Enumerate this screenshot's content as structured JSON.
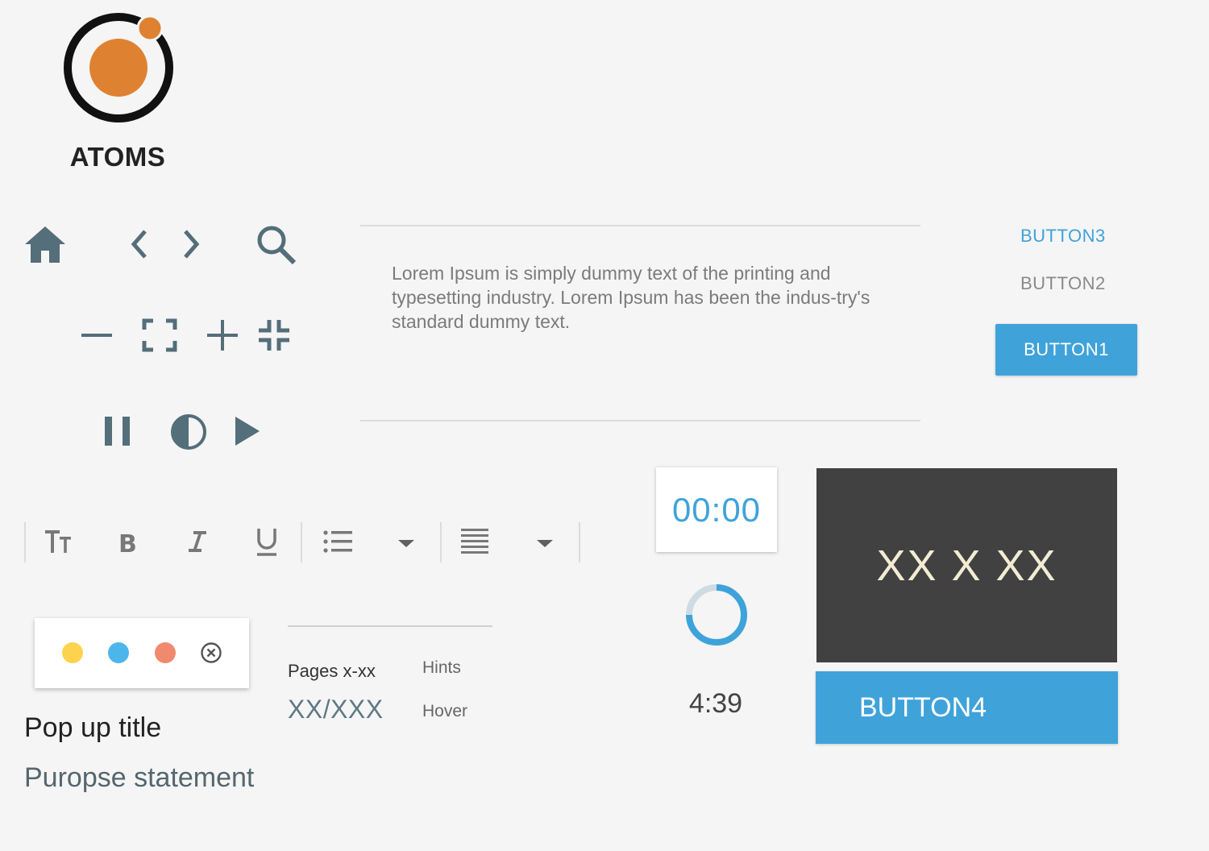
{
  "logo": {
    "title": "ATOMS",
    "icon": "atom-logo-icon",
    "colors": {
      "ring": "#111111",
      "core": "#de8232"
    }
  },
  "nav_icons": {
    "row1": [
      "home-icon",
      "chevron-left-icon",
      "chevron-right-icon",
      "search-icon"
    ],
    "row2": [
      "minus-icon",
      "fullscreen-icon",
      "plus-icon",
      "exit-fullscreen-icon"
    ],
    "row3": [
      "pause-icon",
      "contrast-icon",
      "play-icon"
    ],
    "color": "#546e7a"
  },
  "content": {
    "lorem": "Lorem Ipsum is simply dummy text of the printing and typesetting industry. Lorem Ipsum has been the indus-try's standard dummy text."
  },
  "buttons": {
    "button3": "BUTTON3",
    "button2": "BUTTON2",
    "button1": "BUTTON1",
    "button4": "BUTTON4",
    "accent": "#3fa3da"
  },
  "timer": {
    "display": "00:00",
    "elapsed": "4:39"
  },
  "video": {
    "label": "XX X XX"
  },
  "toolbar": {
    "items": [
      "text-size-icon",
      "bold-icon",
      "italic-icon",
      "underline-icon",
      "bullet-list-icon",
      "dropdown-arrow-icon",
      "align-justify-icon",
      "dropdown-arrow-icon"
    ]
  },
  "color_picker": {
    "colors": [
      "#fdd34e",
      "#4cb6ea",
      "#f08a6e"
    ],
    "close_icon": "close-circle-icon"
  },
  "popup": {
    "title": "Pop up title",
    "purpose": "Puropse statement"
  },
  "pagination": {
    "label": "Pages x-xx",
    "value": "XX/XXX",
    "hints": "Hints",
    "hover": "Hover"
  }
}
